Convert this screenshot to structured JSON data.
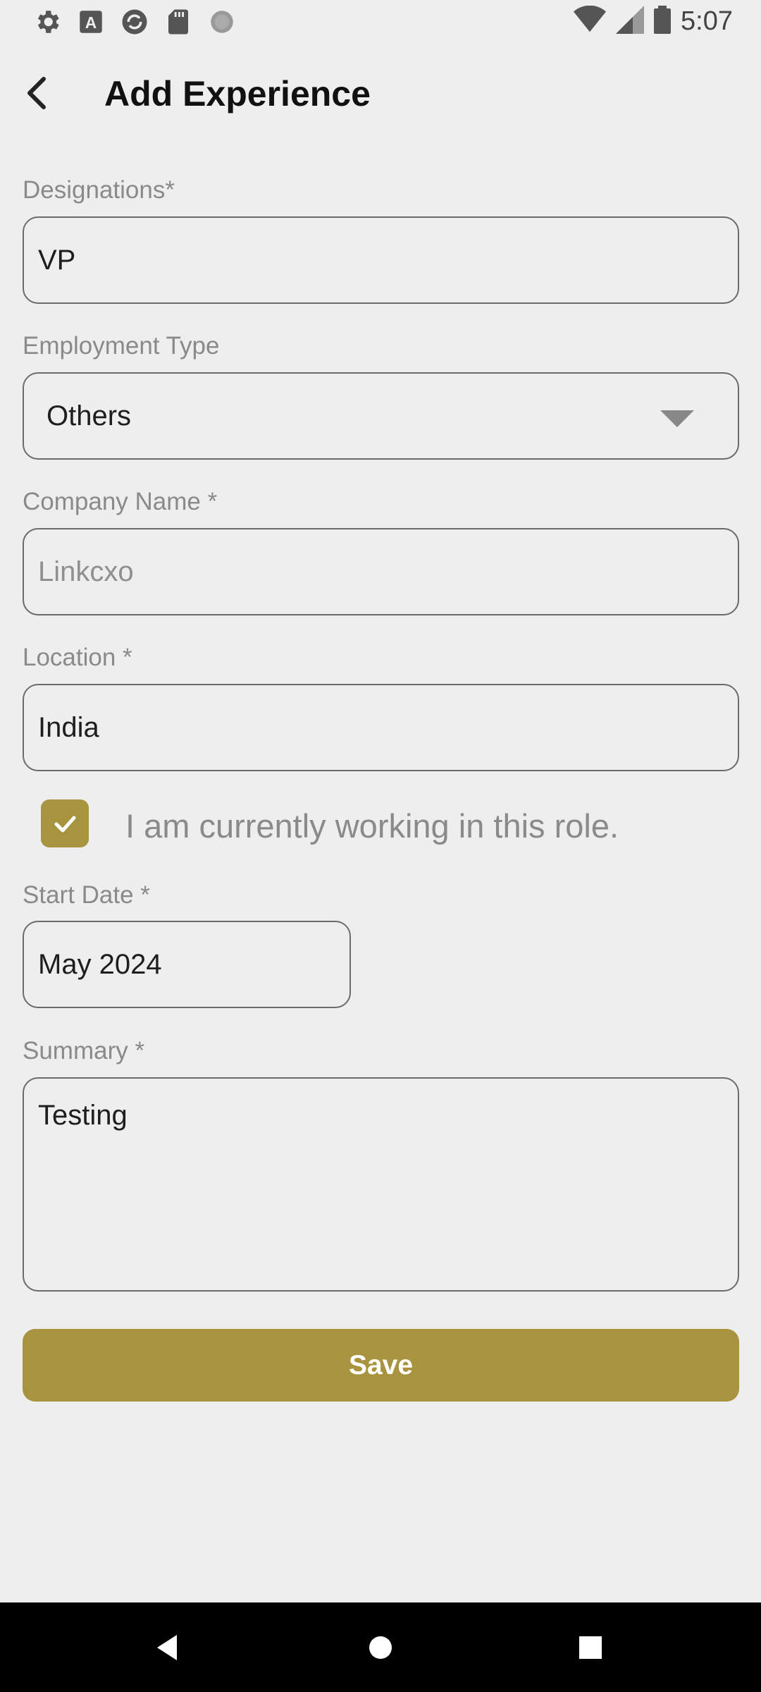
{
  "status_bar": {
    "time": "5:07",
    "left_icons": [
      "settings-icon",
      "font-icon",
      "sync-icon",
      "sd-card-icon",
      "loading-icon"
    ],
    "right_icons": [
      "wifi-icon",
      "signal-icon",
      "battery-icon"
    ]
  },
  "app_bar": {
    "title": "Add Experience",
    "back_icon": "back-arrow-icon"
  },
  "form": {
    "designation": {
      "label": "Designations*",
      "value": "VP"
    },
    "employment_type": {
      "label": "Employment Type",
      "value": "Others"
    },
    "company_name": {
      "label": "Company Name *",
      "placeholder": "Linkcxo"
    },
    "location": {
      "label": "Location *",
      "value": "India"
    },
    "currently_working": {
      "label": "I am currently working in this role.",
      "checked": true
    },
    "start_date": {
      "label": "Start Date *",
      "value": "May 2024"
    },
    "summary": {
      "label": "Summary *",
      "value": "Testing"
    },
    "save_label": "Save"
  },
  "nav_bar": {
    "icons": [
      "nav-back-icon",
      "nav-home-icon",
      "nav-recents-icon"
    ]
  },
  "colors": {
    "accent": "#a8943f",
    "background": "#eeeeee",
    "label": "#8a8a8a"
  }
}
